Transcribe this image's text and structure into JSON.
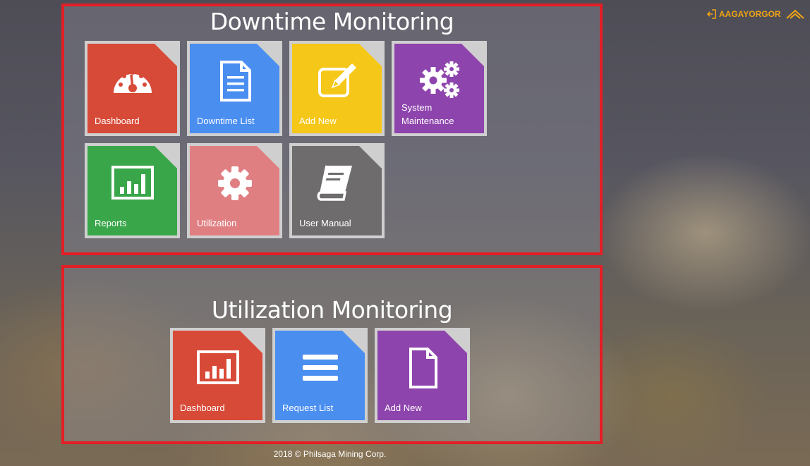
{
  "header": {
    "username": "AAGAYORGOR",
    "logout_icon": "logout-icon",
    "logo_icon": "mountain-logo-icon",
    "accent_color": "#f0a314"
  },
  "downtime": {
    "title": "Downtime Monitoring",
    "tiles": [
      {
        "label": "Dashboard",
        "icon": "speedometer-icon",
        "color": "#d84a38"
      },
      {
        "label": "Downtime List",
        "icon": "document-icon",
        "color": "#4a8ef0"
      },
      {
        "label": "Add New",
        "icon": "edit-icon",
        "color": "#f5c718"
      },
      {
        "label": "System Maintenance",
        "icon": "gears-icon",
        "color": "#8e44ad"
      },
      {
        "label": "Reports",
        "icon": "bar-chart-icon",
        "color": "#3aa64a"
      },
      {
        "label": "Utilization",
        "icon": "gear-icon",
        "color": "#e07f82"
      },
      {
        "label": "User Manual",
        "icon": "book-icon",
        "color": "#6f6c6e"
      }
    ]
  },
  "utilization": {
    "title": "Utilization Monitoring",
    "tiles": [
      {
        "label": "Dashboard",
        "icon": "bar-chart-icon",
        "color": "#d84a38"
      },
      {
        "label": "Request List",
        "icon": "list-icon",
        "color": "#4a8ef0"
      },
      {
        "label": "Add New",
        "icon": "file-icon",
        "color": "#8e44ad"
      }
    ]
  },
  "footer": {
    "text": "2018 © Philsaga Mining Corp."
  },
  "section_border_color": "#e31e24"
}
